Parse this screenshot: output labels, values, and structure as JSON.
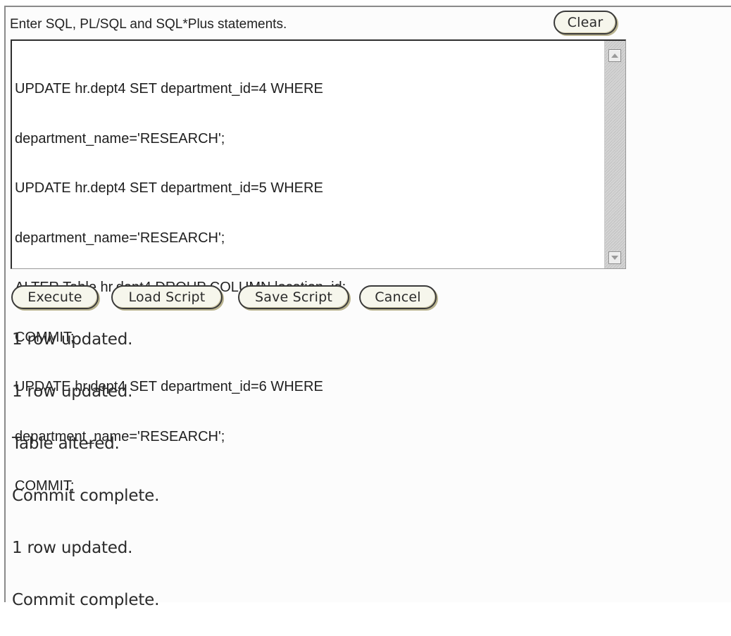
{
  "prompt": {
    "label": "Enter SQL, PL/SQL and SQL*Plus statements.",
    "clear_label": "Clear"
  },
  "editor": {
    "lines": [
      "UPDATE hr.dept4 SET department_id=4 WHERE",
      "department_name='RESEARCH';",
      "UPDATE hr.dept4 SET department_id=5 WHERE",
      "department_name='RESEARCH';",
      "ALTER Table hr.dept4 DROUP COLUMN location_id;",
      "COMMIT;",
      "UPDATE hr.dept4 SET department_id=6 WHERE",
      "department_name='RESEARCH';",
      "COMMIT;"
    ]
  },
  "buttons": {
    "execute": "Execute",
    "load_script": "Load Script",
    "save_script": "Save Script",
    "cancel": "Cancel"
  },
  "output": {
    "messages": [
      "1 row updated.",
      "1 row updated.",
      "Table altered.",
      "Commit complete.",
      "1 row updated.",
      "Commit complete."
    ]
  },
  "icons": {
    "scroll_up": "scroll-up-arrow-icon",
    "scroll_down": "scroll-down-arrow-icon"
  }
}
